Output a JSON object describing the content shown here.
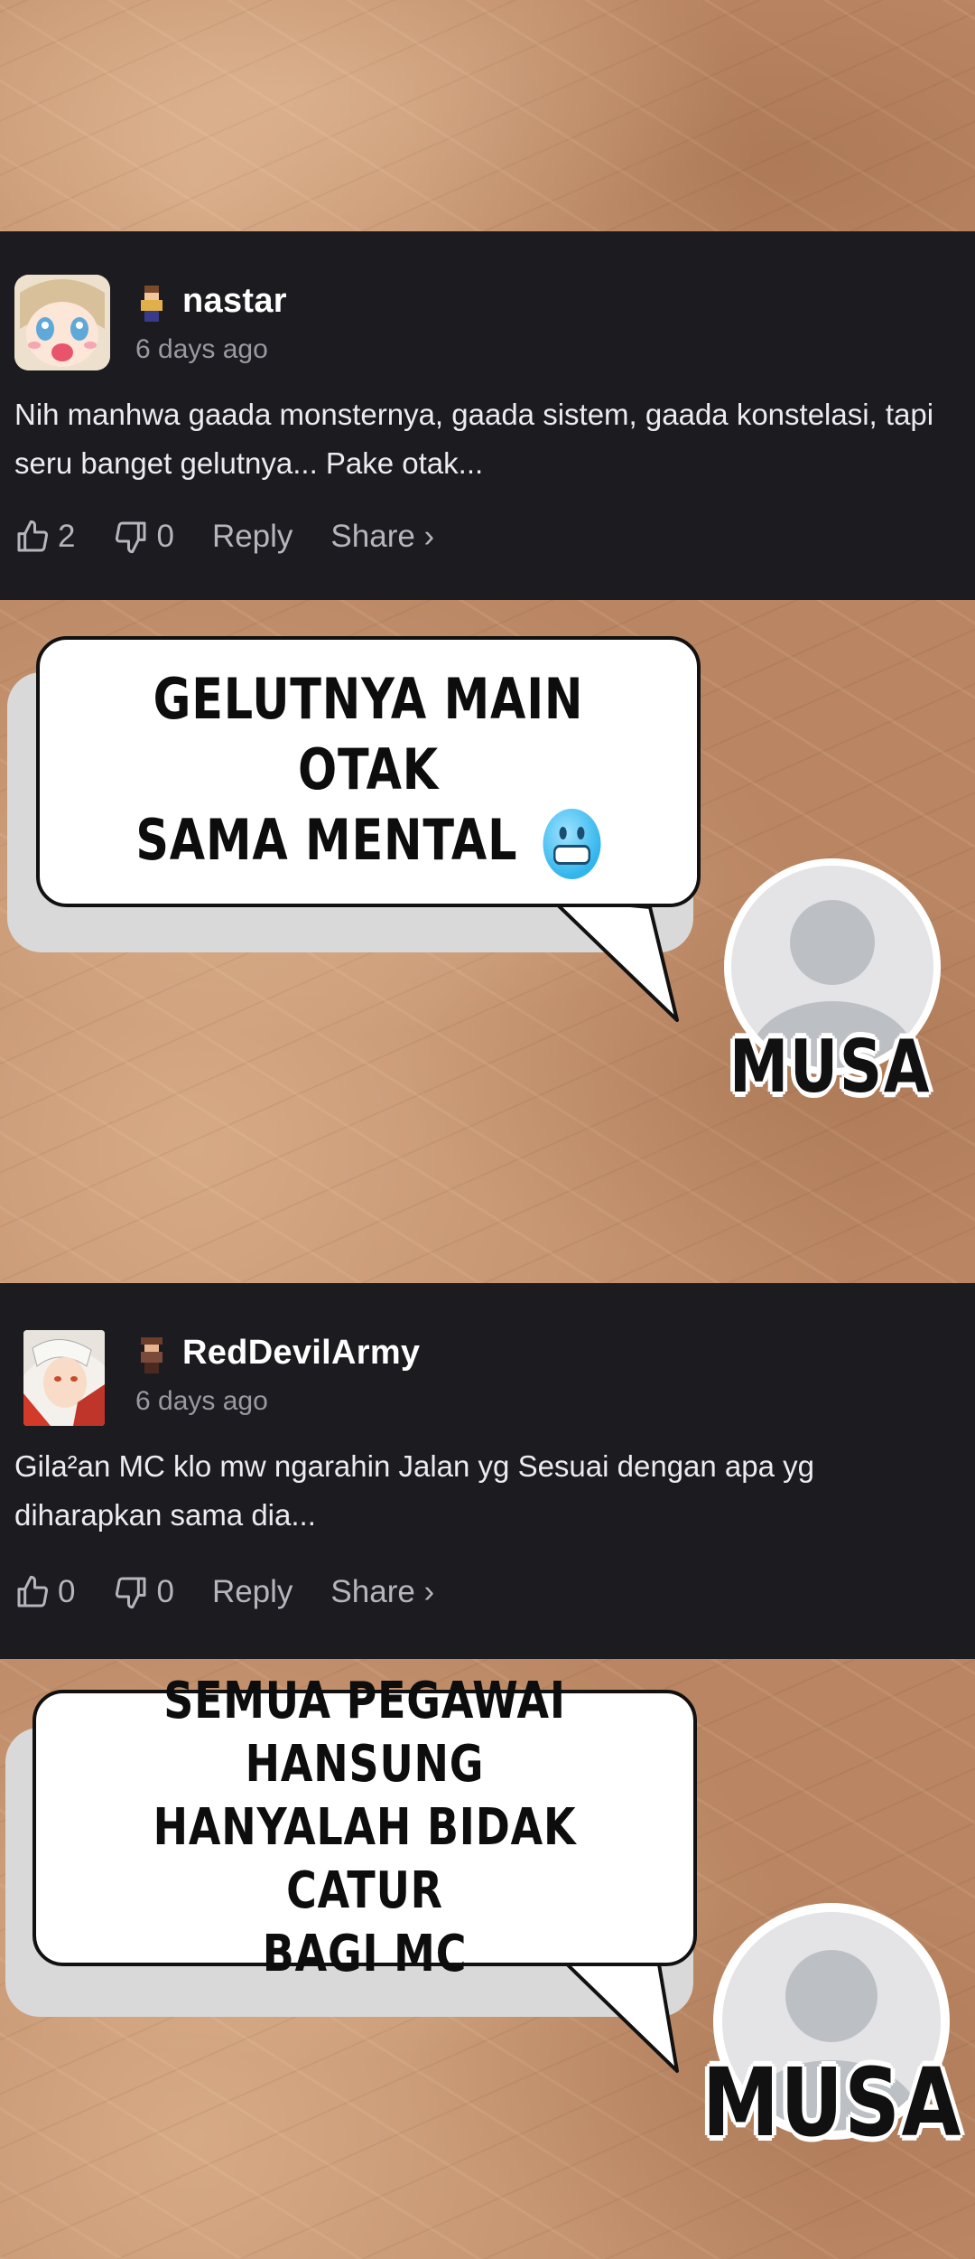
{
  "comments": [
    {
      "username": "nastar",
      "timestamp": "6 days ago",
      "body": "Nih manhwa gaada monsternya, gaada sistem, gaada konstelasi, tapi seru banget gelutnya... Pake otak...",
      "likes": "2",
      "dislikes": "0",
      "reply_label": "Reply",
      "share_label": "Share ›",
      "avatar_icon": "anime-girl-avatar",
      "rank_icon": "pixel-character-icon"
    },
    {
      "username": "RedDevilArmy",
      "timestamp": "6 days ago",
      "body": "Gila²an MC klo mw ngarahin Jalan yg Sesuai dengan apa yg diharapkan sama dia...",
      "likes": "0",
      "dislikes": "0",
      "reply_label": "Reply",
      "share_label": "Share ›",
      "avatar_icon": "anime-boy-avatar",
      "rank_icon": "pixel-character-icon"
    }
  ],
  "bubbles": [
    {
      "line1": "GELUTNYA MAIN OTAK",
      "line2": "SAMA MENTAL",
      "emoji": "cold-face-emoji",
      "author": "MUSA"
    },
    {
      "line1": "SEMUA PEGAWAI HANSUNG",
      "line2": "HANYALAH BIDAK CATUR",
      "line3": "BAGI MC",
      "author": "MUSA"
    }
  ],
  "colors": {
    "comment_bg": "#1c1b20",
    "sand": "#c89672",
    "username": "#ffffff",
    "muted": "#9a99a2"
  }
}
